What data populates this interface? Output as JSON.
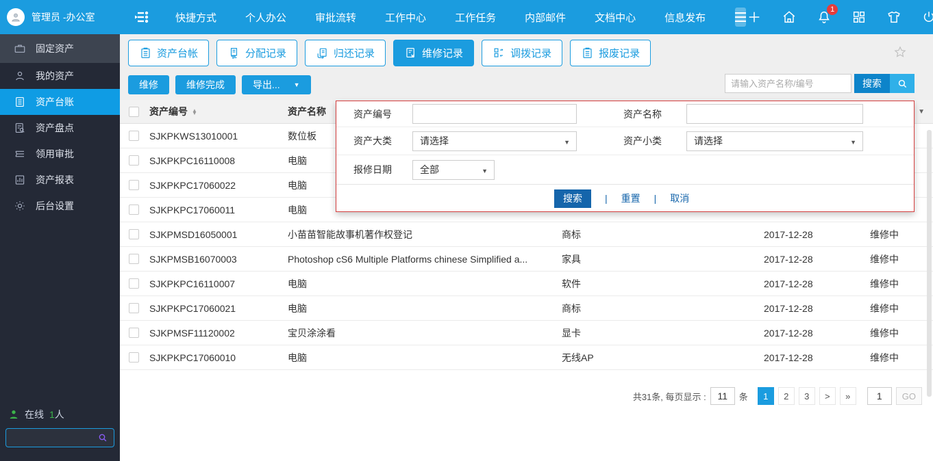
{
  "colors": {
    "topbar_blue": "#1b9cdf",
    "sidebar_dark": "#242936",
    "sidebar_active": "#0f9ce4",
    "panel_border_red": "#d43d3d",
    "deep_blue": "#1565ab",
    "badge_red": "#e63c3c",
    "online_green": "#3cb54a"
  },
  "topbar": {
    "user": "管理员 -办公室",
    "nav_items": [
      "快捷方式",
      "个人办公",
      "审批流转",
      "工作中心",
      "工作任务",
      "内部邮件",
      "文档中心",
      "信息发布"
    ],
    "notification_count": "1",
    "icons": [
      "collapse-menu",
      "hamburger",
      "plus",
      "home",
      "bell",
      "apps",
      "shirt",
      "power"
    ]
  },
  "sidebar": {
    "items": [
      {
        "label": "固定资产",
        "icon": "briefcase"
      },
      {
        "label": "我的资产",
        "icon": "person"
      },
      {
        "label": "资产台账",
        "icon": "file-lines",
        "active": true
      },
      {
        "label": "资产盘点",
        "icon": "file-search"
      },
      {
        "label": "领用审批",
        "icon": "layers"
      },
      {
        "label": "资产报表",
        "icon": "report"
      },
      {
        "label": "后台设置",
        "icon": "gear"
      }
    ],
    "online_label": "在线",
    "online_count": "1",
    "online_unit": "人"
  },
  "tabs": [
    {
      "label": "资产台帐",
      "icon": "clipboard"
    },
    {
      "label": "分配记录",
      "icon": "doc-transfer"
    },
    {
      "label": "归还记录",
      "icon": "doc-return"
    },
    {
      "label": "维修记录",
      "icon": "doc-repair",
      "active": true
    },
    {
      "label": "调拨记录",
      "icon": "blocks-transfer"
    },
    {
      "label": "报废记录",
      "icon": "clipboard"
    }
  ],
  "toolbar": {
    "repair": "维修",
    "repair_done": "维修完成",
    "export": "导出...",
    "search_placeholder": "请输入资产名称/编号",
    "search": "搜索"
  },
  "filter_panel": {
    "labels": {
      "code": "资产编号",
      "name": "资产名称",
      "major_class": "资产大类",
      "minor_class": "资产小类",
      "repair_date": "报修日期"
    },
    "values": {
      "code": "",
      "name": "",
      "major_class": "请选择",
      "minor_class": "请选择",
      "repair_date": "全部"
    },
    "buttons": {
      "search": "搜索",
      "reset": "重置",
      "cancel": "取消"
    }
  },
  "table": {
    "headers": {
      "code": "资产编号",
      "name": "资产名称"
    },
    "rows": [
      {
        "code": "SJKPKWS13010001",
        "name": "数位板",
        "category": "",
        "date": "",
        "status": ""
      },
      {
        "code": "SJKPKPC16110008",
        "name": "电脑",
        "category": "",
        "date": "",
        "status": ""
      },
      {
        "code": "SJKPKPC17060022",
        "name": "电脑",
        "category": "",
        "date": "",
        "status": ""
      },
      {
        "code": "SJKPKPC17060011",
        "name": "电脑",
        "category": "",
        "date": "",
        "status": ""
      },
      {
        "code": "SJKPMSD16050001",
        "name": "小苗苗智能故事机著作权登记",
        "category": "商标",
        "date": "2017-12-28",
        "status": "维修中"
      },
      {
        "code": "SJKPMSB16070003",
        "name": "Photoshop cS6 Multiple Platforms chinese Simplified a...",
        "category": "家具",
        "date": "2017-12-28",
        "status": "维修中"
      },
      {
        "code": "SJKPKPC16110007",
        "name": "电脑",
        "category": "软件",
        "date": "2017-12-28",
        "status": "维修中"
      },
      {
        "code": "SJKPKPC17060021",
        "name": "电脑",
        "category": "商标",
        "date": "2017-12-28",
        "status": "维修中"
      },
      {
        "code": "SJKPMSF11120002",
        "name": "宝贝涂涂看",
        "category": "显卡",
        "date": "2017-12-28",
        "status": "维修中"
      },
      {
        "code": "SJKPKPC17060010",
        "name": "电脑",
        "category": "无线AP",
        "date": "2017-12-28",
        "status": "维修中"
      }
    ]
  },
  "pagination": {
    "summary": "共31条, 每页显示 :",
    "page_size": "11",
    "unit": "条",
    "pages": [
      "1",
      "2",
      "3",
      ">",
      "»"
    ],
    "active_index": 0,
    "goto_value": "1",
    "go_label": "GO"
  }
}
